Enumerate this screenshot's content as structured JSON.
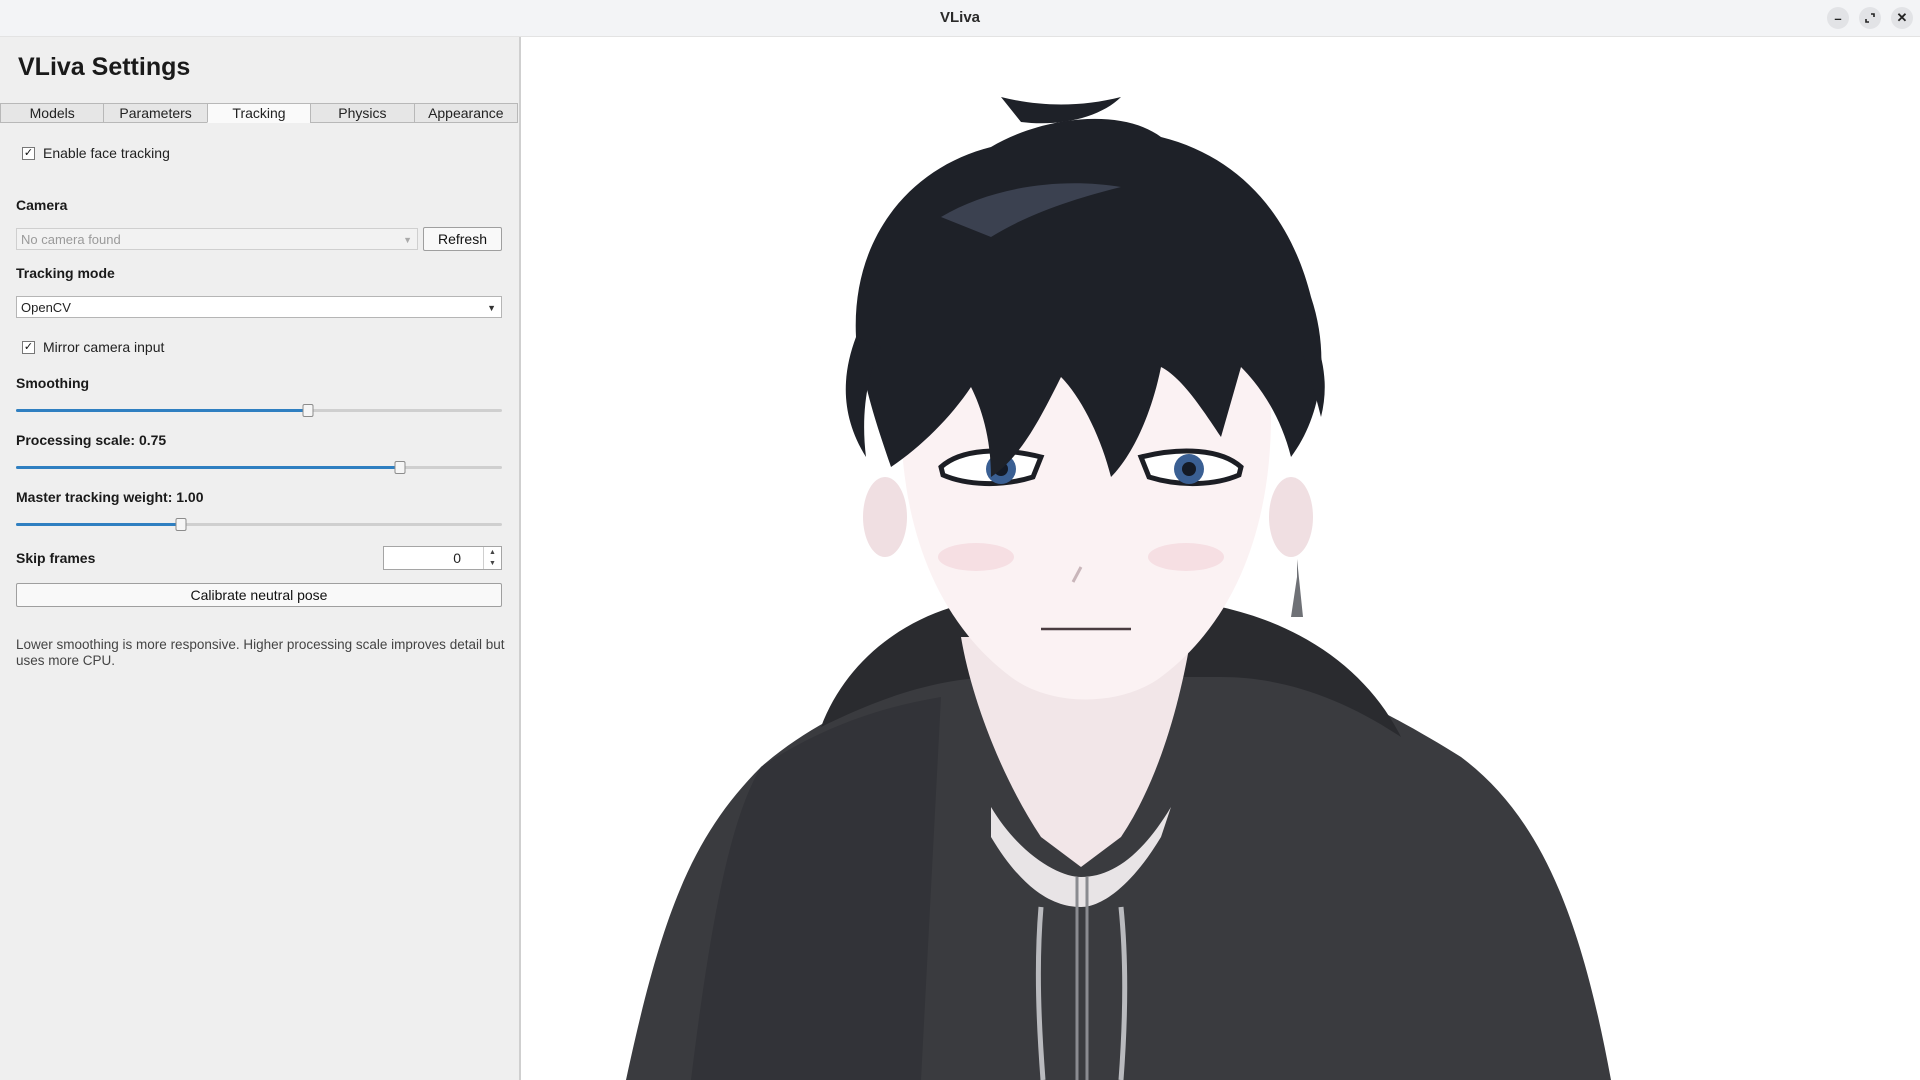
{
  "window": {
    "title": "VLiva"
  },
  "panel": {
    "title": "VLiva Settings",
    "tabs": [
      "Models",
      "Parameters",
      "Tracking",
      "Physics",
      "Appearance"
    ],
    "active_tab": "Tracking",
    "enable_face_tracking": {
      "label": "Enable face tracking",
      "checked": true
    },
    "camera": {
      "label": "Camera",
      "placeholder": "No camera found",
      "refresh_label": "Refresh"
    },
    "tracking_mode": {
      "label": "Tracking mode",
      "value": "OpenCV"
    },
    "mirror_camera": {
      "label": "Mirror camera input",
      "checked": true
    },
    "smoothing": {
      "label": "Smoothing",
      "fraction": 0.6
    },
    "processing_scale": {
      "label": "Processing scale: 0.75",
      "fraction": 0.79
    },
    "master_weight": {
      "label": "Master tracking weight: 1.00",
      "fraction": 0.34
    },
    "skip_frames": {
      "label": "Skip frames",
      "value": "0"
    },
    "calibrate_label": "Calibrate neutral pose",
    "hint": "Lower smoothing is more responsive. Higher processing scale improves detail but uses more CPU."
  },
  "icons": {
    "minimize": "minimize-icon",
    "maximize": "maximize-icon",
    "close": "close-icon"
  },
  "colors": {
    "accent": "#2f7fc1",
    "panel_bg": "#efefef",
    "hoodie": "#3a3b3f",
    "hair": "#1e2128",
    "eye": "#3a5f93"
  }
}
